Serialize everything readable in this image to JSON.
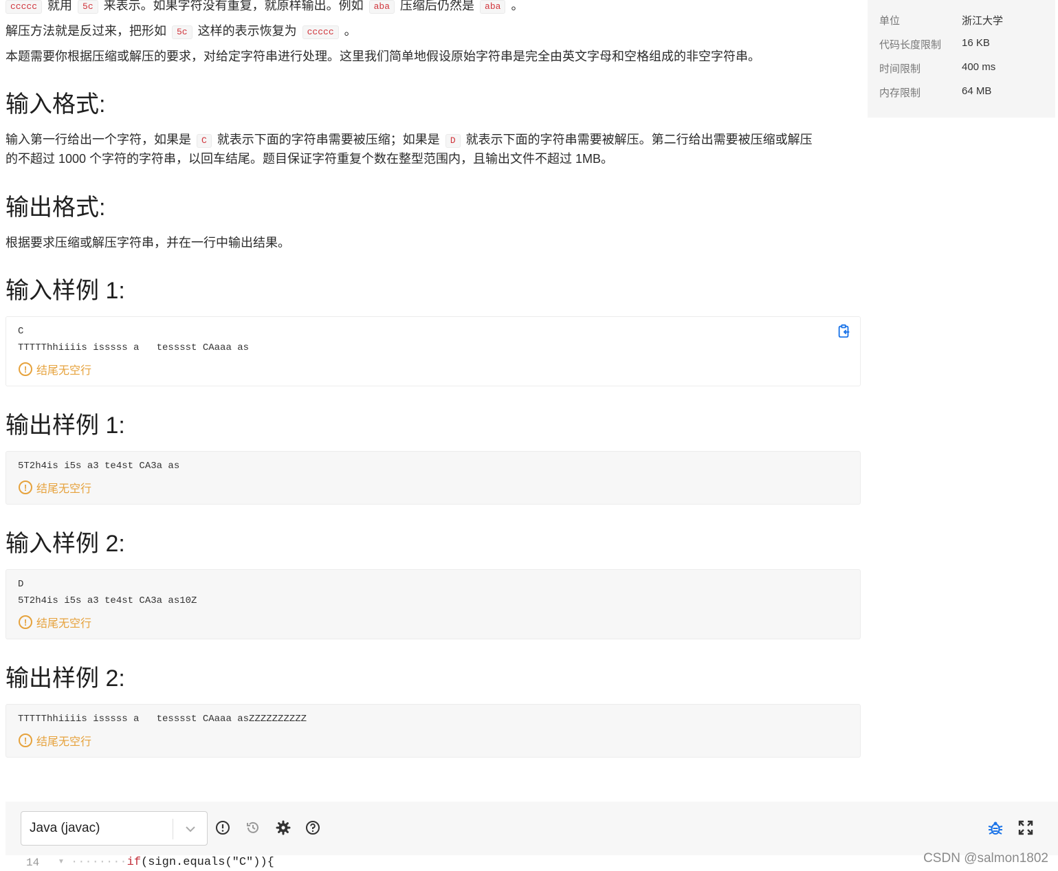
{
  "description": {
    "line1": {
      "code1": "ccccc",
      "t1": "就用",
      "code2": "5c",
      "t2": "来表示。如果字符没有重复，就原样输出。例如",
      "code3": "aba",
      "t3": "压缩后仍然是",
      "code4": "aba",
      "t4": "。"
    },
    "line2": {
      "t1": "解压方法就是反过来，把形如",
      "code1": "5c",
      "t2": "这样的表示恢复为",
      "code2": "ccccc",
      "t3": "。"
    },
    "line3": "本题需要你根据压缩或解压的要求，对给定字符串进行处理。这里我们简单地假设原始字符串是完全由英文字母和空格组成的非空字符串。"
  },
  "input_format": {
    "heading": "输入格式:",
    "t1": "输入第一行给出一个字符，如果是",
    "code1": "C",
    "t2": "就表示下面的字符串需要被压缩；如果是",
    "code2": "D",
    "t3": "就表示下面的字符串需要被解压。第二行给出需要被压缩或解压",
    "line2": "的不超过 1000 个字符的字符串，以回车结尾。题目保证字符重复个数在整型范围内，且输出文件不超过 1MB。"
  },
  "output_format": {
    "heading": "输出格式:",
    "text": "根据要求压缩或解压字符串，并在一行中输出结果。"
  },
  "samples": [
    {
      "heading": "输入样例 1:",
      "content": "C\nTTTTThhiiiis isssss a   tesssst CAaaa as",
      "note": "结尾无空行"
    },
    {
      "heading": "输出样例 1:",
      "content": "5T2h4is i5s a3 te4st CA3a as",
      "note": "结尾无空行"
    },
    {
      "heading": "输入样例 2:",
      "content": "D\n5T2h4is i5s a3 te4st CA3a as10Z",
      "note": "结尾无空行"
    },
    {
      "heading": "输出样例 2:",
      "content": "TTTTThhiiiis isssss a   tesssst CAaaa asZZZZZZZZZZ",
      "note": "结尾无空行"
    }
  ],
  "sidebar": {
    "rows": [
      {
        "key": "单位",
        "value": "浙江大学"
      },
      {
        "key": "代码长度限制",
        "value": "16 KB"
      },
      {
        "key": "时间限制",
        "value": "400 ms"
      },
      {
        "key": "内存限制",
        "value": "64 MB"
      }
    ]
  },
  "editor": {
    "language": "Java (javac)",
    "line_number": "14",
    "code_indent": "········",
    "code_keyword": "if",
    "code_rest": "(sign.equals(\"C\")){"
  },
  "watermark": "CSDN @salmon1802",
  "colors": {
    "inline_code": "#d0343b",
    "warning": "#e6a23c",
    "accent": "#1a73e8"
  }
}
